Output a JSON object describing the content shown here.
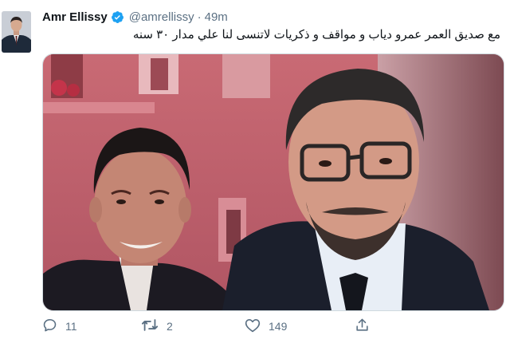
{
  "tweet": {
    "author_name": "Amr Ellissy",
    "handle": "@amrellissy",
    "separator": "·",
    "time": "49m",
    "text": "مع صديق العمر عمرو دياب و مواقف و ذكريات لاتنسى لنا علي مدار ٣٠ سنه"
  },
  "icons": {
    "verified": "verified-badge-icon",
    "reply": "reply-icon",
    "retweet": "retweet-icon",
    "like": "heart-icon",
    "share": "share-icon"
  },
  "actions": {
    "reply_count": "11",
    "retweet_count": "2",
    "like_count": "149"
  },
  "colors": {
    "verified": "#1da1f2",
    "secondary_text": "#5b7083"
  }
}
